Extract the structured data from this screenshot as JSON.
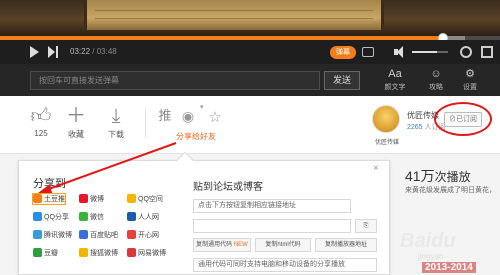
{
  "player": {
    "time_current": "03:22",
    "time_total": "03:48",
    "progress": 0.885,
    "buffered": 0.93,
    "volume": 0.7,
    "danmu_toggle_label": "弹幕",
    "danmu_placeholder": "按回车可直接发送弹幕",
    "send_label": "发送",
    "tools": [
      {
        "label": "颜文字",
        "icon": "emoticon-icon",
        "glyph": "Aa"
      },
      {
        "label": "攻略",
        "icon": "guide-icon",
        "glyph": "☺"
      },
      {
        "label": "设置",
        "icon": "settings-icon",
        "glyph": "⚙"
      }
    ]
  },
  "actions": {
    "like_count": "125",
    "collect_label": "收藏",
    "download_label": "下载",
    "recommend_label": "推",
    "share_label": "分享给好友"
  },
  "channel": {
    "logo_text": "优匠传媒",
    "name": "优匠传媒",
    "subs_count": "2265",
    "subs_suffix": "人订阅",
    "subscribed_label": "已订阅"
  },
  "right_panel": {
    "plays_prefix": "41万",
    "plays_suffix": "次播放",
    "desc": "来黄花级发展成了明日黄花，"
  },
  "share_popup": {
    "title": "分享到",
    "platforms": [
      {
        "label": "土豆推",
        "icon": "tudou-icon",
        "color": "#f27f1c",
        "selected": true
      },
      {
        "label": "微博",
        "icon": "weibo-icon",
        "color": "#e6162d"
      },
      {
        "label": "QQ空间",
        "icon": "qzone-icon",
        "color": "#f5b400"
      },
      {
        "label": "QQ分享",
        "icon": "qq-icon",
        "color": "#2c8fe6"
      },
      {
        "label": "微信",
        "icon": "wechat-icon",
        "color": "#3bb33b"
      },
      {
        "label": "人人网",
        "icon": "renren-icon",
        "color": "#1f5aa8"
      },
      {
        "label": "腾讯微博",
        "icon": "tencent-weibo-icon",
        "color": "#3a9bd9"
      },
      {
        "label": "百度贴吧",
        "icon": "baidu-tieba-icon",
        "color": "#3a6fd9"
      },
      {
        "label": "开心网",
        "icon": "kaixin-icon",
        "color": "#e8403c"
      },
      {
        "label": "豆瓣",
        "icon": "douban-icon",
        "color": "#2f9e3e"
      },
      {
        "label": "搜狐微博",
        "icon": "sohu-weibo-icon",
        "color": "#f2b600"
      },
      {
        "label": "网易微博",
        "icon": "netease-weibo-icon",
        "color": "#d93a3a"
      }
    ],
    "bbs_title": "贴到论坛或博客",
    "bbs_hint": "点击下方按钮复制相应链接地址",
    "copy_buttons": [
      {
        "label": "复制通用代码",
        "tag": "NEW"
      },
      {
        "label": "复制html代码",
        "tag": ""
      },
      {
        "label": "复制播放器地址",
        "tag": ""
      }
    ],
    "bbs_universal": "通用代码可同时支持电脑和移动设备的分享播放"
  },
  "watermark": {
    "brand": "Baidu",
    "sub": "jingyan",
    "year": "2013-2014"
  },
  "colors": {
    "accent": "#f27f1c",
    "highlight": "#e01818",
    "link": "#3a7fcf"
  }
}
